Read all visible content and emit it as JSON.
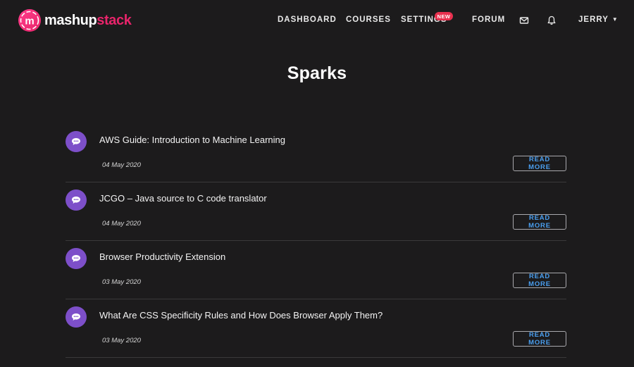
{
  "brand": {
    "name_part1": "mashup",
    "name_part2": "stack",
    "accent": "#e8246a"
  },
  "nav": {
    "dashboard": "DASHBOARD",
    "courses": "COURSES",
    "settings": "SETTINGS",
    "settings_badge": "NEW",
    "forum": "FORUM",
    "mail_icon": "mail-icon",
    "bell_icon": "bell-icon",
    "user": "JERRY"
  },
  "page": {
    "title": "Sparks"
  },
  "posts": [
    {
      "title": "AWS Guide: Introduction to Machine Learning",
      "date": "04 May 2020",
      "button": "READ MORE"
    },
    {
      "title": "JCGO – Java source to C code translator",
      "date": "04 May 2020",
      "button": "READ MORE"
    },
    {
      "title": "Browser Productivity Extension",
      "date": "03 May 2020",
      "button": "READ MORE"
    },
    {
      "title": "What Are CSS Specificity Rules and How Does Browser Apply Them?",
      "date": "03 May 2020",
      "button": "READ MORE"
    }
  ],
  "colors": {
    "background": "#1c1b1c",
    "post_icon": "#7d4fc9",
    "button_text": "#4a9ff0",
    "badge": "#e8314f"
  }
}
